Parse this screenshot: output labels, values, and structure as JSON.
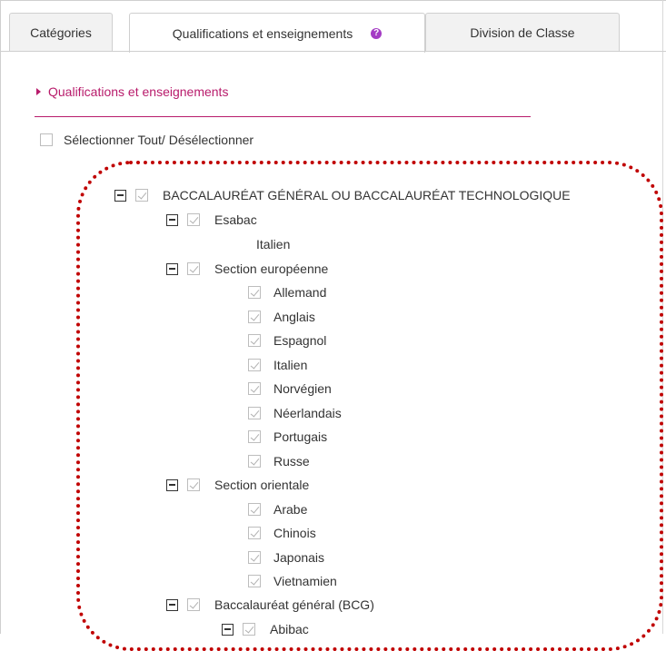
{
  "tabs": [
    {
      "label": "Catégories",
      "active": false
    },
    {
      "label": "Qualifications et enseignements",
      "active": true,
      "help_icon": "help-circle-icon"
    },
    {
      "label": "Division de Classe",
      "active": false
    }
  ],
  "section": {
    "title": "Qualifications et enseignements",
    "accent_color": "#b81b6b"
  },
  "select_all": {
    "label": "Sélectionner Tout/ Désélectionner",
    "checked": false
  },
  "tree": {
    "root": "BACCALAURÉAT GÉNÉRAL OU BACCALAURÉAT TECHNOLOGIQUE",
    "esabac": {
      "label": "Esabac",
      "child": "Italien"
    },
    "europeenne": {
      "label": "Section européenne",
      "items": [
        "Allemand",
        "Anglais",
        "Espagnol",
        "Italien",
        "Norvégien",
        "Néerlandais",
        "Portugais",
        "Russe"
      ]
    },
    "orientale": {
      "label": "Section orientale",
      "items": [
        "Arabe",
        "Chinois",
        "Japonais",
        "Vietnamien"
      ]
    },
    "bcg": {
      "label": "Baccalauréat général (BCG)",
      "child": "Abibac"
    }
  },
  "annotation_color": "#c00000"
}
